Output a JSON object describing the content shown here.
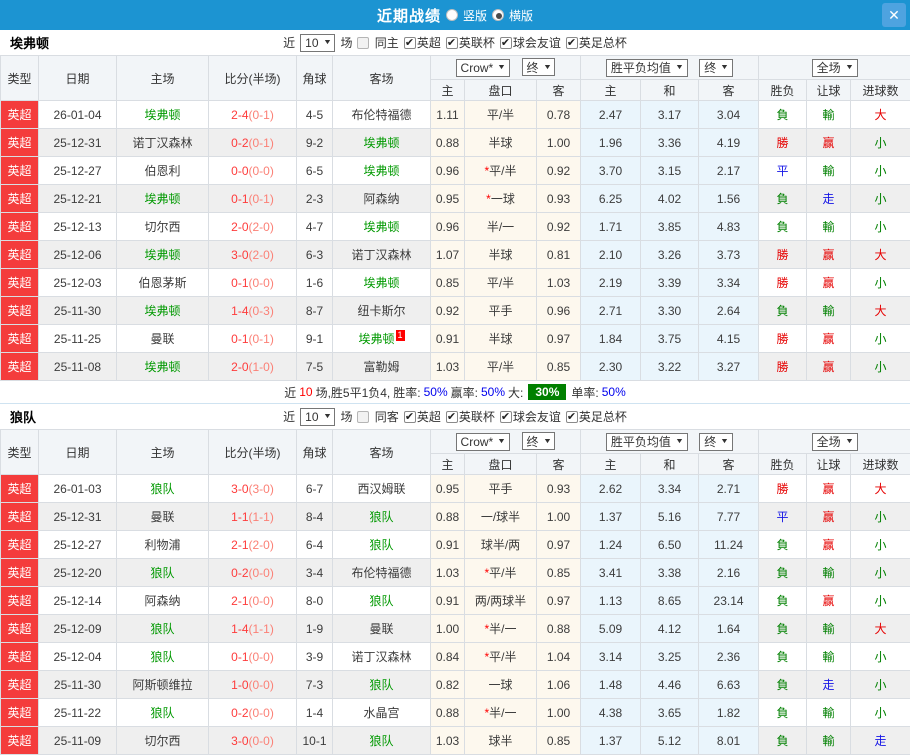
{
  "titlebar": {
    "title": "近期战绩",
    "vertical_label": "竖版",
    "horizontal_label": "横版",
    "selected_layout": "横版",
    "close_icon": "✕"
  },
  "colors": {
    "header_blue": "#1c94d2",
    "league_red": "#f43c3c",
    "self_team_green": "#009900",
    "score_red": "#fe3b3b",
    "win_red": "#e60000",
    "lose_green": "#008000",
    "draw_blue": "#1414e6",
    "percent_blue": "#0000ee",
    "over_badge_green": "#008000",
    "handicap_col_bg": "#fdf8ee",
    "avg_col_bg": "#eaf5fc"
  },
  "table_header": {
    "col_type": "类型",
    "col_date": "日期",
    "col_home": "主场",
    "col_score": "比分(半场)",
    "col_corner": "角球",
    "col_away": "客场",
    "company_select": "Crow*",
    "final_select": "终",
    "avg_select": "胜平负均值",
    "final_select2": "终",
    "scope_select": "全场",
    "sub_home": "主",
    "sub_handicap": "盘口",
    "sub_away": "客",
    "sub_avg_home": "主",
    "sub_avg_draw": "和",
    "sub_avg_away": "客",
    "sub_result": "胜负",
    "sub_handicap_result": "让球",
    "sub_goals": "进球数"
  },
  "sections": [
    {
      "team": "埃弗顿",
      "filter": {
        "near_label": "近",
        "count": "10",
        "games_label": "场",
        "same_label": "同主",
        "same_checked": false,
        "leagues": [
          {
            "label": "英超",
            "checked": true
          },
          {
            "label": "英联杯",
            "checked": true
          },
          {
            "label": "球会友谊",
            "checked": true
          },
          {
            "label": "英足总杯",
            "checked": true
          }
        ]
      },
      "rows": [
        {
          "league": "英超",
          "date": "26-01-04",
          "home": "埃弗顿",
          "score": "2-4",
          "half": "(0-1)",
          "corner": "4-5",
          "away": "布伦特福德",
          "odd_home": "1.11",
          "handicap": "平/半",
          "odd_away": "0.78",
          "avg_home": "2.47",
          "avg_draw": "3.17",
          "avg_away": "3.04",
          "result": "負",
          "handicap_result": "輸",
          "goals_result": "大"
        },
        {
          "league": "英超",
          "date": "25-12-31",
          "home": "诺丁汉森林",
          "score": "0-2",
          "half": "(0-1)",
          "corner": "9-2",
          "away": "埃弗顿",
          "odd_home": "0.88",
          "handicap": "半球",
          "odd_away": "1.00",
          "avg_home": "1.96",
          "avg_draw": "3.36",
          "avg_away": "4.19",
          "result": "勝",
          "handicap_result": "赢",
          "goals_result": "小"
        },
        {
          "league": "英超",
          "date": "25-12-27",
          "home": "伯恩利",
          "score": "0-0",
          "half": "(0-0)",
          "corner": "6-5",
          "away": "埃弗顿",
          "odd_home": "0.96",
          "handicap": "*平/半",
          "odd_away": "0.92",
          "avg_home": "3.70",
          "avg_draw": "3.15",
          "avg_away": "2.17",
          "result": "平",
          "handicap_result": "輸",
          "goals_result": "小"
        },
        {
          "league": "英超",
          "date": "25-12-21",
          "home": "埃弗顿",
          "score": "0-1",
          "half": "(0-1)",
          "corner": "2-3",
          "away": "阿森纳",
          "odd_home": "0.95",
          "handicap": "*一球",
          "odd_away": "0.93",
          "avg_home": "6.25",
          "avg_draw": "4.02",
          "avg_away": "1.56",
          "result": "負",
          "handicap_result": "走",
          "goals_result": "小"
        },
        {
          "league": "英超",
          "date": "25-12-13",
          "home": "切尔西",
          "score": "2-0",
          "half": "(2-0)",
          "corner": "4-7",
          "away": "埃弗顿",
          "odd_home": "0.96",
          "handicap": "半/一",
          "odd_away": "0.92",
          "avg_home": "1.71",
          "avg_draw": "3.85",
          "avg_away": "4.83",
          "result": "負",
          "handicap_result": "輸",
          "goals_result": "小"
        },
        {
          "league": "英超",
          "date": "25-12-06",
          "home": "埃弗顿",
          "score": "3-0",
          "half": "(2-0)",
          "corner": "6-3",
          "away": "诺丁汉森林",
          "odd_home": "1.07",
          "handicap": "半球",
          "odd_away": "0.81",
          "avg_home": "2.10",
          "avg_draw": "3.26",
          "avg_away": "3.73",
          "result": "勝",
          "handicap_result": "赢",
          "goals_result": "大"
        },
        {
          "league": "英超",
          "date": "25-12-03",
          "home": "伯恩茅斯",
          "score": "0-1",
          "half": "(0-0)",
          "corner": "1-6",
          "away": "埃弗顿",
          "odd_home": "0.85",
          "handicap": "平/半",
          "odd_away": "1.03",
          "avg_home": "2.19",
          "avg_draw": "3.39",
          "avg_away": "3.34",
          "result": "勝",
          "handicap_result": "赢",
          "goals_result": "小"
        },
        {
          "league": "英超",
          "date": "25-11-30",
          "home": "埃弗顿",
          "score": "1-4",
          "half": "(0-3)",
          "corner": "8-7",
          "away": "纽卡斯尔",
          "odd_home": "0.92",
          "handicap": "平手",
          "odd_away": "0.96",
          "avg_home": "2.71",
          "avg_draw": "3.30",
          "avg_away": "2.64",
          "result": "負",
          "handicap_result": "輸",
          "goals_result": "大"
        },
        {
          "league": "英超",
          "date": "25-11-25",
          "home": "曼联",
          "score": "0-1",
          "half": "(0-1)",
          "corner": "9-1",
          "away": "埃弗顿",
          "away_badge": "1",
          "odd_home": "0.91",
          "handicap": "半球",
          "odd_away": "0.97",
          "avg_home": "1.84",
          "avg_draw": "3.75",
          "avg_away": "4.15",
          "result": "勝",
          "handicap_result": "赢",
          "goals_result": "小"
        },
        {
          "league": "英超",
          "date": "25-11-08",
          "home": "埃弗顿",
          "score": "2-0",
          "half": "(1-0)",
          "corner": "7-5",
          "away": "富勒姆",
          "odd_home": "1.03",
          "handicap": "平/半",
          "odd_away": "0.85",
          "avg_home": "2.30",
          "avg_draw": "3.22",
          "avg_away": "3.27",
          "result": "勝",
          "handicap_result": "赢",
          "goals_result": "小"
        }
      ],
      "summary": {
        "t_near": "近",
        "count": "10",
        "t_record": "场,胜5平1负4,",
        "t_win": "胜率:",
        "win_rate": "50%",
        "t_handicap": "赢率:",
        "handicap_rate": "50%",
        "t_over": "大:",
        "over_rate": "30%",
        "t_single": "单率:",
        "single_rate": "50%"
      }
    },
    {
      "team": "狼队",
      "filter": {
        "near_label": "近",
        "count": "10",
        "games_label": "场",
        "same_label": "同客",
        "same_checked": false,
        "leagues": [
          {
            "label": "英超",
            "checked": true
          },
          {
            "label": "英联杯",
            "checked": true
          },
          {
            "label": "球会友谊",
            "checked": true
          },
          {
            "label": "英足总杯",
            "checked": true
          }
        ]
      },
      "rows": [
        {
          "league": "英超",
          "date": "26-01-03",
          "home": "狼队",
          "score": "3-0",
          "half": "(3-0)",
          "corner": "6-7",
          "away": "西汉姆联",
          "odd_home": "0.95",
          "handicap": "平手",
          "odd_away": "0.93",
          "avg_home": "2.62",
          "avg_draw": "3.34",
          "avg_away": "2.71",
          "result": "勝",
          "handicap_result": "赢",
          "goals_result": "大"
        },
        {
          "league": "英超",
          "date": "25-12-31",
          "home": "曼联",
          "score": "1-1",
          "half": "(1-1)",
          "corner": "8-4",
          "away": "狼队",
          "odd_home": "0.88",
          "handicap": "一/球半",
          "odd_away": "1.00",
          "avg_home": "1.37",
          "avg_draw": "5.16",
          "avg_away": "7.77",
          "result": "平",
          "handicap_result": "赢",
          "goals_result": "小"
        },
        {
          "league": "英超",
          "date": "25-12-27",
          "home": "利物浦",
          "score": "2-1",
          "half": "(2-0)",
          "corner": "6-4",
          "away": "狼队",
          "odd_home": "0.91",
          "handicap": "球半/两",
          "odd_away": "0.97",
          "avg_home": "1.24",
          "avg_draw": "6.50",
          "avg_away": "11.24",
          "result": "負",
          "handicap_result": "赢",
          "goals_result": "小"
        },
        {
          "league": "英超",
          "date": "25-12-20",
          "home": "狼队",
          "score": "0-2",
          "half": "(0-0)",
          "corner": "3-4",
          "away": "布伦特福德",
          "odd_home": "1.03",
          "handicap": "*平/半",
          "odd_away": "0.85",
          "avg_home": "3.41",
          "avg_draw": "3.38",
          "avg_away": "2.16",
          "result": "負",
          "handicap_result": "輸",
          "goals_result": "小"
        },
        {
          "league": "英超",
          "date": "25-12-14",
          "home": "阿森纳",
          "score": "2-1",
          "half": "(0-0)",
          "corner": "8-0",
          "away": "狼队",
          "odd_home": "0.91",
          "handicap": "两/两球半",
          "odd_away": "0.97",
          "avg_home": "1.13",
          "avg_draw": "8.65",
          "avg_away": "23.14",
          "result": "負",
          "handicap_result": "赢",
          "goals_result": "小"
        },
        {
          "league": "英超",
          "date": "25-12-09",
          "home": "狼队",
          "score": "1-4",
          "half": "(1-1)",
          "corner": "1-9",
          "away": "曼联",
          "odd_home": "1.00",
          "handicap": "*半/一",
          "odd_away": "0.88",
          "avg_home": "5.09",
          "avg_draw": "4.12",
          "avg_away": "1.64",
          "result": "負",
          "handicap_result": "輸",
          "goals_result": "大"
        },
        {
          "league": "英超",
          "date": "25-12-04",
          "home": "狼队",
          "score": "0-1",
          "half": "(0-0)",
          "corner": "3-9",
          "away": "诺丁汉森林",
          "odd_home": "0.84",
          "handicap": "*平/半",
          "odd_away": "1.04",
          "avg_home": "3.14",
          "avg_draw": "3.25",
          "avg_away": "2.36",
          "result": "負",
          "handicap_result": "輸",
          "goals_result": "小"
        },
        {
          "league": "英超",
          "date": "25-11-30",
          "home": "阿斯顿维拉",
          "score": "1-0",
          "half": "(0-0)",
          "corner": "7-3",
          "away": "狼队",
          "odd_home": "0.82",
          "handicap": "一球",
          "odd_away": "1.06",
          "avg_home": "1.48",
          "avg_draw": "4.46",
          "avg_away": "6.63",
          "result": "負",
          "handicap_result": "走",
          "goals_result": "小"
        },
        {
          "league": "英超",
          "date": "25-11-22",
          "home": "狼队",
          "score": "0-2",
          "half": "(0-0)",
          "corner": "1-4",
          "away": "水晶宫",
          "odd_home": "0.88",
          "handicap": "*半/一",
          "odd_away": "1.00",
          "avg_home": "4.38",
          "avg_draw": "3.65",
          "avg_away": "1.82",
          "result": "負",
          "handicap_result": "輸",
          "goals_result": "小"
        },
        {
          "league": "英超",
          "date": "25-11-09",
          "home": "切尔西",
          "score": "3-0",
          "half": "(0-0)",
          "corner": "10-1",
          "away": "狼队",
          "odd_home": "1.03",
          "handicap": "球半",
          "odd_away": "0.85",
          "avg_home": "1.37",
          "avg_draw": "5.12",
          "avg_away": "8.01",
          "result": "負",
          "handicap_result": "輸",
          "goals_result": "走"
        }
      ]
    }
  ]
}
